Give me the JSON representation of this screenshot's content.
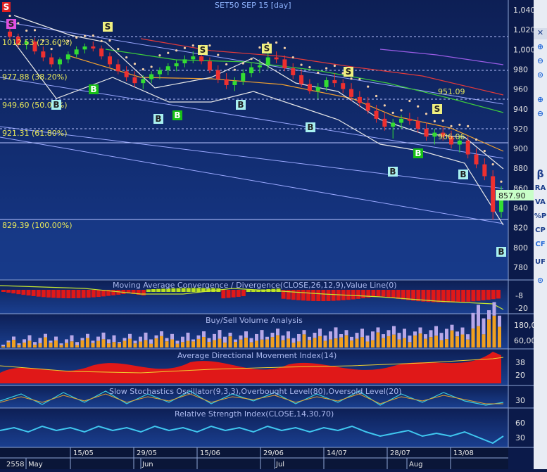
{
  "title": "SET50 SEP 15   [day]",
  "price_axis": {
    "ticks": [
      "1,040",
      "1,020",
      "1,000",
      "980",
      "960",
      "940",
      "920",
      "900",
      "880",
      "860",
      "840",
      "820",
      "800",
      "780"
    ],
    "last_price": "857.90"
  },
  "fib_levels": [
    "1012.53 (23.60%)",
    "977.88 (38.20%)",
    "949.60 (50.00%)",
    "921.31 (61.80%)",
    "829.39 (100.00%)"
  ],
  "annotations": [
    "951.09",
    "906.06"
  ],
  "panels": {
    "macd": {
      "title": "Moving Average Convergence / Divergence(CLOSE,26,12,9),Value Line(0)",
      "ticks": [
        "-8",
        "-20"
      ]
    },
    "volume": {
      "title": "Buy/Sell Volume Analysis",
      "ticks": [
        "180,0",
        "60,00"
      ]
    },
    "adx": {
      "title": "Average Directional Movement Index(14)",
      "ticks": [
        "38",
        "20"
      ]
    },
    "stoch": {
      "title": "Slow Stochastics Oscillator(9,3,3),Overbought Level(80),Oversold Level(20)",
      "ticks": [
        "30"
      ]
    },
    "rsi": {
      "title": "Relative Strength Index(CLOSE,14,30,70)",
      "ticks": [
        "60",
        "30"
      ]
    }
  },
  "date_axis": {
    "top": [
      "15/05",
      "29/05",
      "15/06",
      "29/06",
      "14/07",
      "28/07",
      "13/08"
    ],
    "bottom": [
      "2558",
      "May",
      "Jun",
      "Jul",
      "Aug"
    ]
  },
  "signals": [
    "S",
    "S",
    "S",
    "S",
    "S",
    "S",
    "S",
    "B",
    "B",
    "B",
    "B",
    "B",
    "B",
    "B",
    "B",
    "B",
    "B"
  ],
  "toolbar": {
    "items": [
      "β",
      "RA",
      "VA",
      "%P",
      "CP",
      "CF",
      "UF"
    ]
  },
  "chart_data": {
    "type": "candlestick",
    "title": "SET50 SEP 15   [day]",
    "y_range": [
      775,
      1045
    ],
    "candles": [
      [
        1018,
        1022,
        1010,
        1013
      ],
      [
        1013,
        1016,
        1002,
        1005
      ],
      [
        1005,
        1010,
        1000,
        1008
      ],
      [
        1008,
        1012,
        995,
        998
      ],
      [
        998,
        1003,
        988,
        992
      ],
      [
        992,
        996,
        982,
        985
      ],
      [
        985,
        992,
        980,
        990
      ],
      [
        990,
        998,
        986,
        995
      ],
      [
        995,
        1003,
        992,
        1000
      ],
      [
        1000,
        1006,
        996,
        1003
      ],
      [
        1003,
        1008,
        998,
        1001
      ],
      [
        1001,
        1004,
        990,
        993
      ],
      [
        993,
        997,
        982,
        985
      ],
      [
        985,
        990,
        975,
        978
      ],
      [
        978,
        983,
        968,
        972
      ],
      [
        972,
        978,
        962,
        966
      ],
      [
        966,
        974,
        960,
        970
      ],
      [
        970,
        978,
        966,
        975
      ],
      [
        975,
        982,
        970,
        979
      ],
      [
        979,
        986,
        974,
        983
      ],
      [
        983,
        990,
        978,
        986
      ],
      [
        986,
        994,
        982,
        990
      ],
      [
        990,
        998,
        986,
        993
      ],
      [
        993,
        999,
        985,
        988
      ],
      [
        988,
        992,
        976,
        979
      ],
      [
        979,
        984,
        966,
        970
      ],
      [
        970,
        976,
        960,
        964
      ],
      [
        964,
        972,
        958,
        968
      ],
      [
        968,
        980,
        964,
        976
      ],
      [
        976,
        986,
        972,
        982
      ],
      [
        982,
        990,
        976,
        984
      ],
      [
        984,
        996,
        980,
        992
      ],
      [
        992,
        998,
        986,
        990
      ],
      [
        990,
        994,
        978,
        981
      ],
      [
        981,
        986,
        970,
        974
      ],
      [
        974,
        980,
        962,
        965
      ],
      [
        965,
        970,
        955,
        958
      ],
      [
        958,
        966,
        950,
        962
      ],
      [
        962,
        972,
        958,
        969
      ],
      [
        969,
        976,
        962,
        966
      ],
      [
        966,
        970,
        956,
        960
      ],
      [
        960,
        966,
        948,
        952
      ],
      [
        952,
        958,
        942,
        946
      ],
      [
        946,
        952,
        935,
        938
      ],
      [
        938,
        944,
        926,
        930
      ],
      [
        930,
        936,
        918,
        922
      ],
      [
        922,
        930,
        910,
        926
      ],
      [
        926,
        934,
        920,
        930
      ],
      [
        930,
        936,
        924,
        928
      ],
      [
        928,
        932,
        916,
        920
      ],
      [
        920,
        926,
        908,
        912
      ],
      [
        912,
        920,
        904,
        916
      ],
      [
        916,
        922,
        908,
        912
      ],
      [
        912,
        918,
        900,
        904
      ],
      [
        904,
        912,
        896,
        908
      ],
      [
        908,
        912,
        890,
        894
      ],
      [
        894,
        900,
        880,
        884
      ],
      [
        884,
        890,
        868,
        872
      ],
      [
        872,
        878,
        828,
        836
      ],
      [
        836,
        862,
        830,
        858
      ]
    ]
  }
}
